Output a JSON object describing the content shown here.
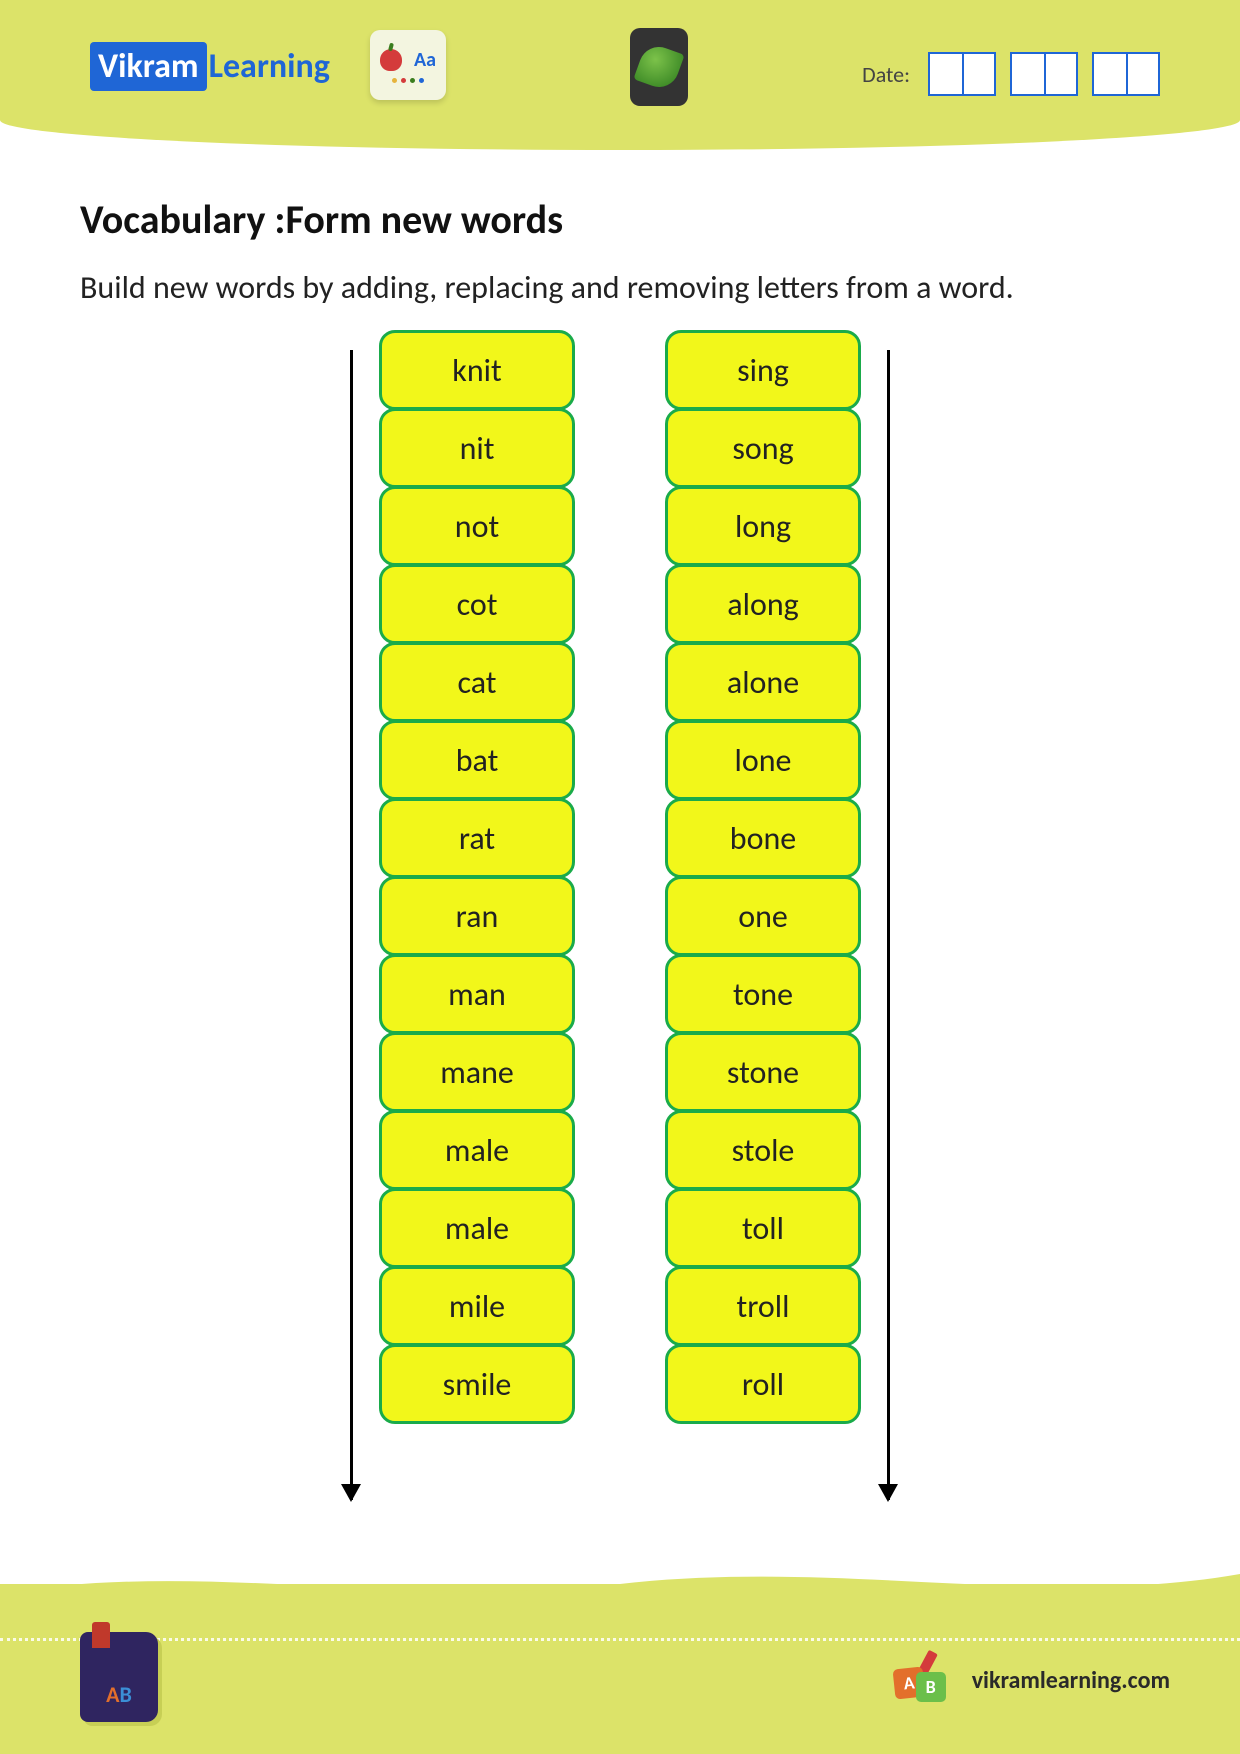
{
  "header": {
    "brand_part1": "Vikram",
    "brand_part2": "Learning",
    "icon_card_text": "Aa",
    "date_label": "Date:"
  },
  "title": "Vocabulary :Form new words",
  "instructions": "Build new words by adding, replacing and removing letters from a word.",
  "columns": {
    "left": [
      "knit",
      "nit",
      "not",
      "cot",
      "cat",
      "bat",
      "rat",
      "ran",
      "man",
      "mane",
      "male",
      "male",
      "mile",
      "smile"
    ],
    "right": [
      "sing",
      "song",
      "long",
      "along",
      "alone",
      "lone",
      "bone",
      "one",
      "tone",
      "stone",
      "stole",
      "toll",
      "troll",
      "roll"
    ]
  },
  "footer": {
    "book_letters_a": "A",
    "book_letters_b": "B",
    "tile_a": "A",
    "tile_b": "B",
    "url": "vikramlearning.com"
  }
}
